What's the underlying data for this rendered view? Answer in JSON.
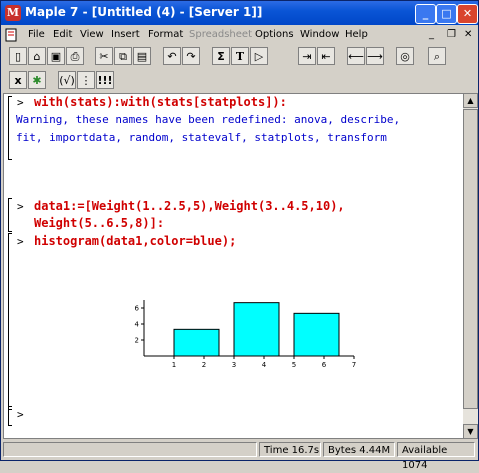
{
  "window": {
    "title": "Maple 7 - [Untitled (4) - [Server 1]]",
    "app_icon_letter": "M"
  },
  "menu": {
    "items": [
      {
        "label": "File",
        "disabled": false
      },
      {
        "label": "Edit",
        "disabled": false
      },
      {
        "label": "View",
        "disabled": false
      },
      {
        "label": "Insert",
        "disabled": false
      },
      {
        "label": "Format",
        "disabled": false
      },
      {
        "label": "Spreadsheet",
        "disabled": true
      },
      {
        "label": "Options",
        "disabled": false
      },
      {
        "label": "Window",
        "disabled": false
      },
      {
        "label": "Help",
        "disabled": false
      }
    ]
  },
  "toolbar1": {
    "icons": [
      "new-icon",
      "open-icon",
      "save-icon",
      "print-icon",
      "cut-icon",
      "copy-icon",
      "paste-icon",
      "undo-icon",
      "redo-icon",
      "sigma-icon",
      "text-icon",
      "execute-icon",
      "indent-icon",
      "outdent-icon",
      "back-icon",
      "forward-icon",
      "stop-icon",
      "zoom-icon"
    ],
    "glyphs": {
      "sigma": "Σ",
      "text": "T"
    }
  },
  "toolbar2": {
    "icons": [
      "x-icon",
      "bug-icon",
      "fx-icon",
      "dots-icon",
      "exclaim-icon"
    ],
    "glyphs": {
      "x": "x",
      "fx": "(√)",
      "dots": "⋮",
      "exclaim": "!!!"
    }
  },
  "worksheet": {
    "prompt_symbol": ">",
    "groups": [
      {
        "input": "with(stats):with(stats[statplots]):"
      },
      {
        "input": "data1:=[Weight(1..2.5,5),Weight(3..4.5,10),",
        "input_cont": "Weight(5..6.5,8)]:"
      },
      {
        "input": "histogram(data1,color=blue);"
      }
    ],
    "warning_lines": [
      "Warning, these names have been redefined: anova, describe,",
      "fit, importdata, random, statevalf, statplots, transform"
    ]
  },
  "chart_data": {
    "type": "bar",
    "bars": [
      {
        "x0": 1,
        "x1": 2.5,
        "height": 3.333
      },
      {
        "x0": 3,
        "x1": 4.5,
        "height": 6.667
      },
      {
        "x0": 5,
        "x1": 6.5,
        "height": 5.333
      }
    ],
    "xlim": [
      0,
      7
    ],
    "ylim": [
      0,
      7
    ],
    "x_ticks": [
      "1",
      "2",
      "3",
      "4",
      "5",
      "6",
      "7"
    ],
    "y_ticks": [
      "2",
      "4",
      "6"
    ],
    "color": "#00ffff"
  },
  "statusbar": {
    "time": "Time  16.7s",
    "bytes": "Bytes  4.44M",
    "available": "Available  1074"
  },
  "colors": {
    "input_text": "#d00000",
    "warning_text": "#0000cc",
    "title_bar": "#0a55d6"
  }
}
